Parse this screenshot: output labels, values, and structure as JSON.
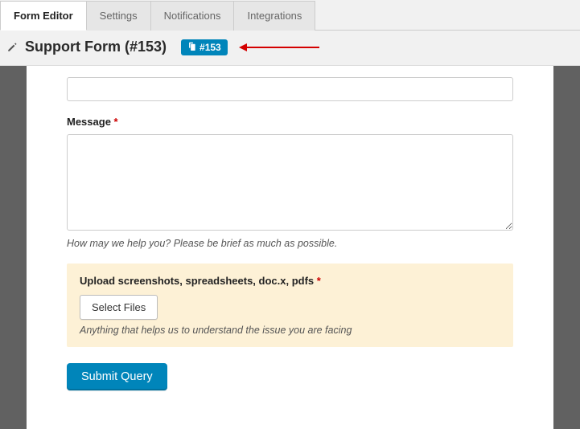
{
  "tabs": {
    "editor": "Form Editor",
    "settings": "Settings",
    "notifications": "Notifications",
    "integrations": "Integrations"
  },
  "header": {
    "title": "Support Form (#153)",
    "badge": "#153"
  },
  "form": {
    "message": {
      "label": "Message",
      "required_mark": "*",
      "help": "How may we help you? Please be brief as much as possible."
    },
    "upload": {
      "label": "Upload screenshots, spreadsheets, doc.x, pdfs",
      "required_mark": "*",
      "button": "Select Files",
      "help": "Anything that helps us to understand the issue you are facing"
    },
    "submit": "Submit Query"
  }
}
